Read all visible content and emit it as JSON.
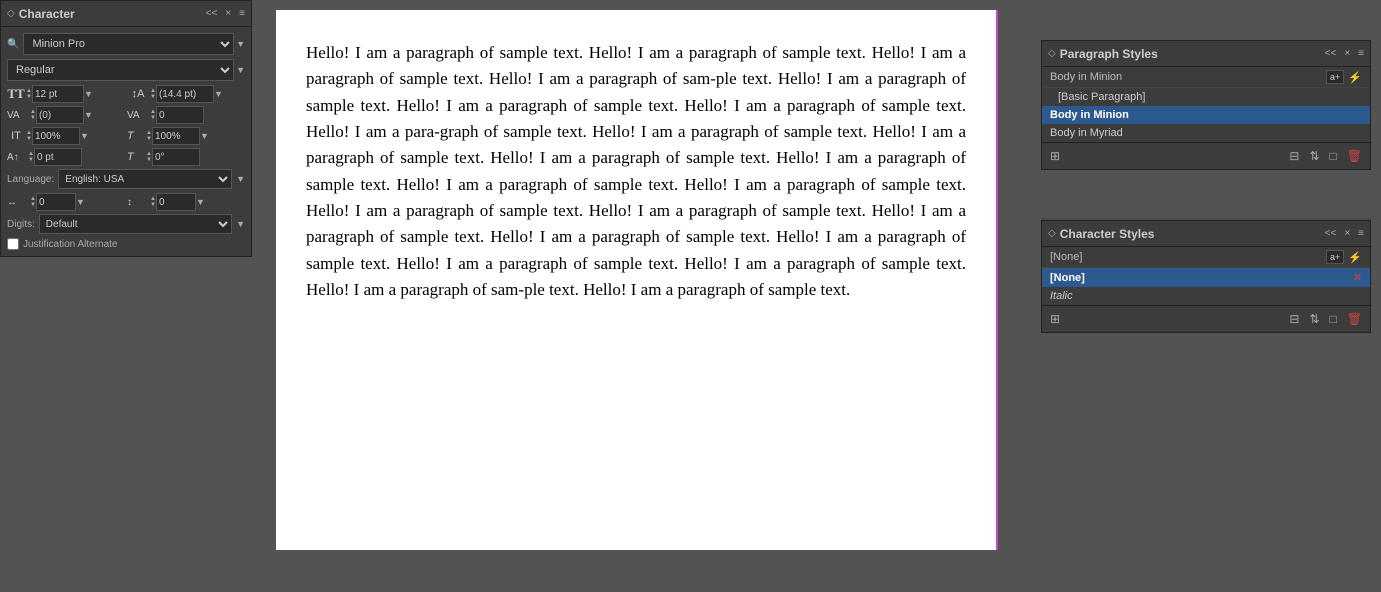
{
  "characterPanel": {
    "title": "Character",
    "collapseLabel": "<<",
    "closeLabel": "×",
    "menuLabel": "≡",
    "font": {
      "name": "Minion Pro",
      "style": "Regular",
      "searchIcon": "🔍"
    },
    "fields": {
      "fontSize": {
        "label": "TT",
        "value": "12 pt",
        "unit": "pt"
      },
      "leading": {
        "label": "↕",
        "value": "(14.4 pt)"
      },
      "kerning": {
        "label": "VA",
        "value": "(0)"
      },
      "tracking": {
        "label": "VA",
        "value": "0"
      },
      "vertScale": {
        "label": "IT",
        "value": "100%",
        "unit": "%"
      },
      "horizScale": {
        "label": "T",
        "value": "100%",
        "unit": "%"
      },
      "baseline": {
        "label": "A↑",
        "value": "0 pt"
      },
      "skew": {
        "label": "T",
        "value": "0°"
      }
    },
    "language": {
      "label": "Language:",
      "value": "English: USA"
    },
    "glyphSpacing1": {
      "value": "0"
    },
    "glyphSpacing2": {
      "value": "0"
    },
    "digits": {
      "label": "Digits:",
      "value": "Default"
    },
    "justificationAlt": "Justification Alternate"
  },
  "canvas": {
    "text": "Hello! I am a paragraph of sample text. Hello! I am a paragraph of sample text. Hello! I am a paragraph of sample text. Hello! I am a paragraph of sam-ple text. Hello! I am a paragraph of sample text. Hello! I am a paragraph of sample text. Hello! I am a paragraph of sample text. Hello! I am a para-graph of sample text. Hello! I am a paragraph of sample text. Hello! I am a paragraph of sample text. Hello! I am a paragraph of sample text. Hello! I am a paragraph of sample text. Hello! I am a paragraph of sample text. Hello! I am a paragraph of sample text. Hello! I am a paragraph of sample text. Hello! I am a paragraph of sample text. Hello! I am a paragraph of sample text. Hello! I am a paragraph of sample text. Hello! I am a paragraph of sample text. Hello! I am a paragraph of sample text. Hello! I am a paragraph of sample text. Hello! I am a paragraph of sam-ple text. Hello! I am a paragraph of sample text."
  },
  "paragraphStyles": {
    "title": "Paragraph Styles",
    "collapseLabel": "<<",
    "closeLabel": "×",
    "menuLabel": "≡",
    "newStyleLabel": "a+",
    "lightningLabel": "⚡",
    "items": [
      {
        "name": "Body in Minion",
        "selected": false,
        "basic": false
      },
      {
        "name": "[Basic Paragraph]",
        "selected": false,
        "basic": true
      },
      {
        "name": "Body in Minion",
        "selected": true,
        "basic": false
      },
      {
        "name": "Body in Myriad",
        "selected": false,
        "basic": false
      }
    ],
    "footer": {
      "loadIcon": "⊞",
      "newIcon": "□+",
      "deleteIcon": "🗑"
    }
  },
  "characterStyles": {
    "title": "Character Styles",
    "collapseLabel": "<<",
    "closeLabel": "×",
    "menuLabel": "≡",
    "newStyleLabel": "a+",
    "lightningLabel": "⚡",
    "noneLabel": "[None]",
    "deleteIcon": "✕",
    "items": [
      {
        "name": "[None]",
        "selected": true
      },
      {
        "name": "Italic",
        "selected": false,
        "italic": true
      }
    ],
    "footer": {
      "loadIcon": "⊞",
      "newIcon": "□+",
      "deleteIcon": "🗑"
    }
  }
}
